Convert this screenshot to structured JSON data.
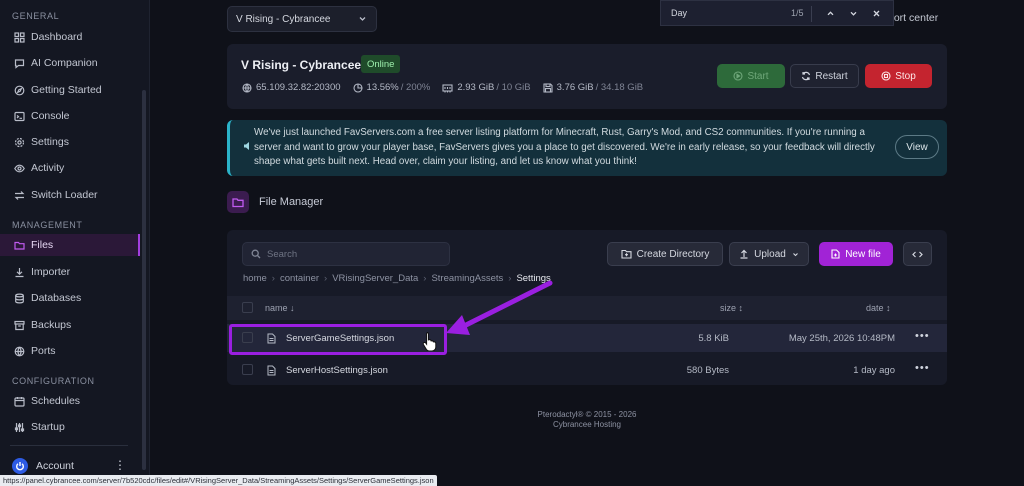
{
  "sidebar": {
    "sections": {
      "general": "GENERAL",
      "management": "MANAGEMENT",
      "configuration": "CONFIGURATION"
    },
    "items": [
      {
        "label": "Dashboard",
        "icon": "grid-icon"
      },
      {
        "label": "AI Companion",
        "icon": "chat-icon"
      },
      {
        "label": "Getting Started",
        "icon": "compass-icon"
      },
      {
        "label": "Console",
        "icon": "terminal-icon"
      },
      {
        "label": "Settings",
        "icon": "gear-icon"
      },
      {
        "label": "Activity",
        "icon": "eye-icon"
      },
      {
        "label": "Switch Loader",
        "icon": "switch-icon"
      },
      {
        "label": "Files",
        "icon": "folder-icon",
        "active": true
      },
      {
        "label": "Importer",
        "icon": "download-icon"
      },
      {
        "label": "Databases",
        "icon": "database-icon"
      },
      {
        "label": "Backups",
        "icon": "archive-icon"
      },
      {
        "label": "Ports",
        "icon": "network-icon"
      },
      {
        "label": "Schedules",
        "icon": "calendar-icon"
      },
      {
        "label": "Startup",
        "icon": "sliders-icon"
      }
    ],
    "account": {
      "label": "Account"
    }
  },
  "header": {
    "server_select": "V Rising - Cybrancee",
    "support": "port center"
  },
  "findbar": {
    "query": "Day",
    "count": "1/5"
  },
  "server": {
    "name": "V Rising - Cybrancee",
    "status": "Online",
    "address": "65.109.32.82:20300",
    "cpu": "13.56%",
    "cpu_limit": "/ 200%",
    "memory": "2.93 GiB",
    "memory_limit": "/ 10 GiB",
    "disk": "3.76 GiB",
    "disk_limit": "/ 34.18 GiB",
    "buttons": {
      "start": "Start",
      "restart": "Restart",
      "stop": "Stop"
    }
  },
  "banner": {
    "text": "We've just launched FavServers.com a free server listing platform for Minecraft, Rust, Garry's Mod, and CS2 communities. If you're running a server and want to grow your player base, FavServers gives you a place to get discovered. We're in early release, so your feedback will directly shape what gets built next. Head over, claim your listing, and let us know what you think!",
    "button": "View"
  },
  "file_manager": {
    "title": "File Manager",
    "search_placeholder": "Search",
    "buttons": {
      "create_directory": "Create Directory",
      "upload": "Upload",
      "new_file": "New file"
    },
    "breadcrumb": [
      "home",
      "container",
      "VRisingServer_Data",
      "StreamingAssets",
      "Settings"
    ],
    "columns": {
      "name": "name ↓",
      "size": "size ↕",
      "date": "date ↕"
    },
    "files": [
      {
        "name": "ServerGameSettings.json",
        "size": "5.8 KiB",
        "date": "May 25th, 2026 10:48PM"
      },
      {
        "name": "ServerHostSettings.json",
        "size": "580 Bytes",
        "date": "1 day ago"
      }
    ]
  },
  "footer": {
    "line1": "Pterodactyl® © 2015 - 2026",
    "line2": "Cybrancee Hosting"
  },
  "status_url": "https://panel.cybrancee.com/server/7b520cdc/files/edit#/VRisingServer_Data/StreamingAssets/Settings/ServerGameSettings.json",
  "colors": {
    "accent": "#a123d6",
    "online": "#1f4b2a",
    "stop": "#c4242f",
    "start": "#2d6a3a",
    "banner": "#13303c"
  }
}
